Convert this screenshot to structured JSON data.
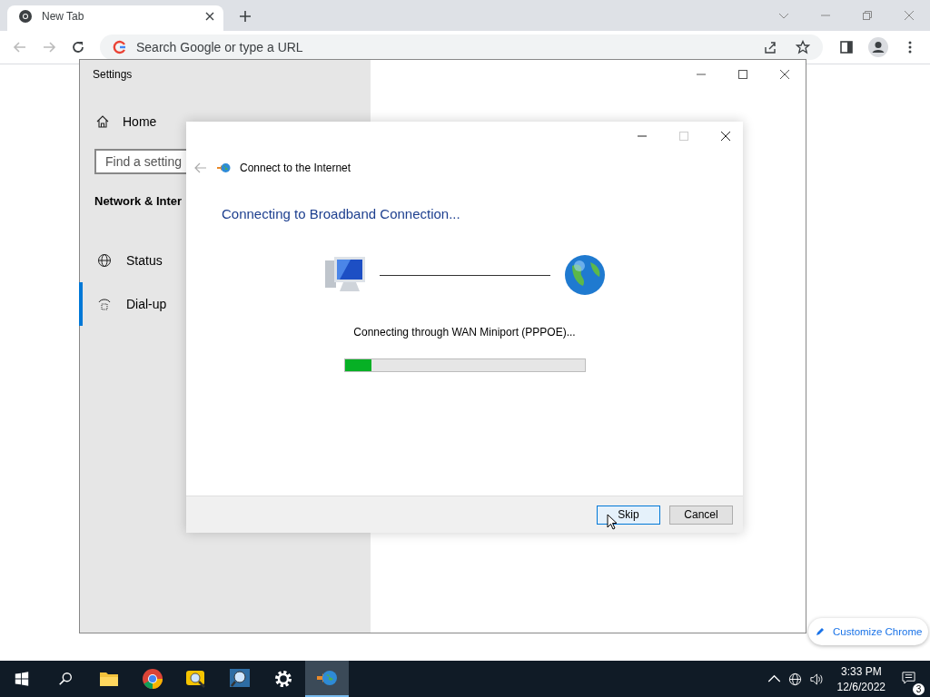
{
  "browser": {
    "tab": {
      "title": "New Tab"
    },
    "address": {
      "placeholder": "Search Google or type a URL"
    },
    "customize": {
      "label": "Customize Chrome"
    }
  },
  "settings": {
    "title": "Settings",
    "home": "Home",
    "search": {
      "placeholder": "Find a setting"
    },
    "section": "Network & Inter",
    "items": [
      {
        "kind": "status",
        "label": "Status",
        "selected": false
      },
      {
        "kind": "dialup",
        "label": "Dial-up",
        "selected": true
      }
    ]
  },
  "dialog": {
    "title": "Connect to the Internet",
    "heading": "Connecting to Broadband Connection...",
    "status": "Connecting through WAN Miniport (PPPOE)...",
    "progress": {
      "level": 0.11
    },
    "buttons": [
      {
        "label": "Skip",
        "selected": true
      },
      {
        "label": "Cancel",
        "selected": false
      }
    ]
  },
  "taskbar": {
    "apps": [
      {
        "kind": "folder",
        "active": false
      },
      {
        "kind": "chrome",
        "active": false
      },
      {
        "kind": "viewer",
        "active": false
      },
      {
        "kind": "magnifier",
        "active": false
      },
      {
        "kind": "settings",
        "active": false
      },
      {
        "kind": "network",
        "active": true
      }
    ],
    "time": "3:33 PM",
    "date": "12/6/2022",
    "notifications": "3"
  }
}
